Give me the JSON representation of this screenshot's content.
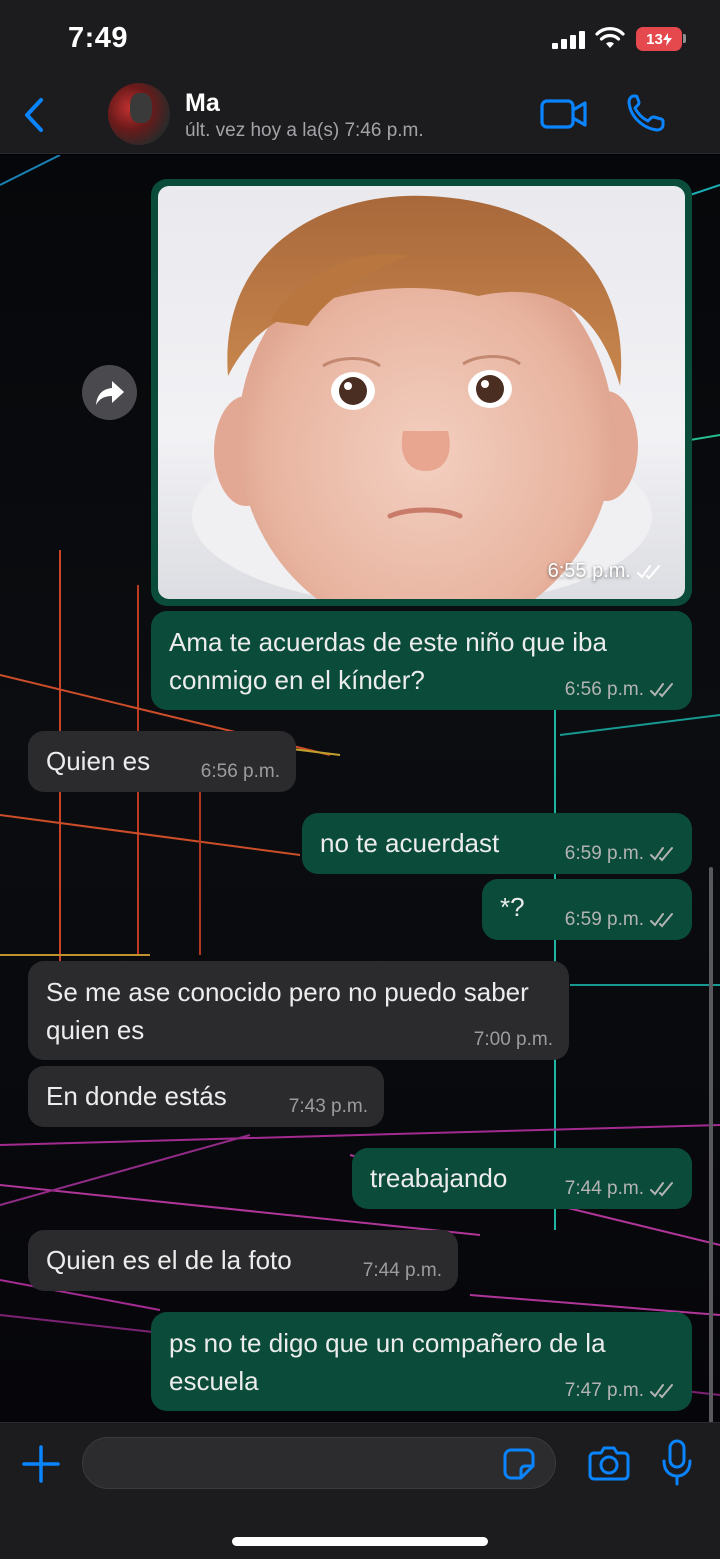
{
  "status_bar": {
    "time": "7:49",
    "battery": "13"
  },
  "header": {
    "contact_name": "Ma",
    "last_seen": "últ. vez hoy a la(s) 7:46 p.m."
  },
  "colors": {
    "accent": "#0a84ff",
    "outgoing_bubble": "#0a4b39",
    "incoming_bubble": "#2b2b2e",
    "battery_low": "#e5484d"
  },
  "icons": {
    "back": "chevron-left-icon",
    "video_call": "video-camera-icon",
    "voice_call": "phone-icon",
    "forward": "share-arrow-icon",
    "attach": "plus-icon",
    "sticker": "sticker-icon",
    "camera": "camera-icon",
    "microphone": "microphone-icon"
  },
  "messages": [
    {
      "type": "image",
      "direction": "out",
      "time": "6:55 p.m.",
      "status": "read"
    },
    {
      "type": "text",
      "direction": "out",
      "text": "Ama te acuerdas de este niño que iba conmigo en el kínder?",
      "time": "6:56 p.m.",
      "status": "read"
    },
    {
      "type": "text",
      "direction": "in",
      "text": "Quien es",
      "time": "6:56 p.m."
    },
    {
      "type": "text",
      "direction": "out",
      "text": "no te acuerdast",
      "time": "6:59 p.m.",
      "status": "read"
    },
    {
      "type": "text",
      "direction": "out",
      "text": "*?",
      "time": "6:59 p.m.",
      "status": "read"
    },
    {
      "type": "text",
      "direction": "in",
      "text": "Se me ase conocido pero no puedo saber quien es",
      "time": "7:00 p.m."
    },
    {
      "type": "text",
      "direction": "in",
      "text": "En donde estás",
      "time": "7:43 p.m."
    },
    {
      "type": "text",
      "direction": "out",
      "text": "treabajando",
      "time": "7:44 p.m.",
      "status": "read"
    },
    {
      "type": "text",
      "direction": "in",
      "text": "Quien es el de la foto",
      "time": "7:44 p.m."
    },
    {
      "type": "text",
      "direction": "out",
      "text": "ps no te digo que un compañero de la escuela",
      "time": "7:47 p.m.",
      "status": "read"
    }
  ],
  "composer": {
    "placeholder": ""
  }
}
